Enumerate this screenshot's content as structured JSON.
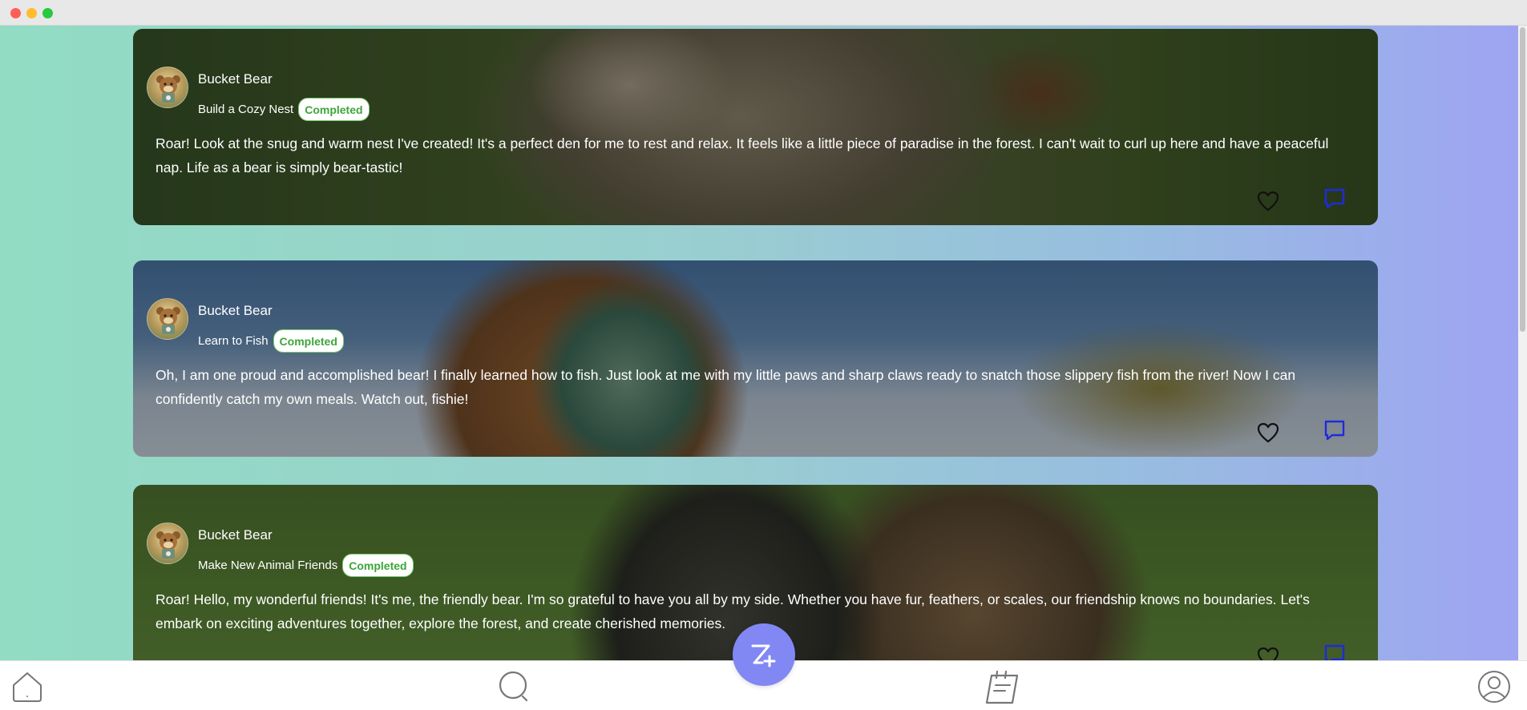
{
  "posts": [
    {
      "username": "Bucket Bear",
      "task": "Build a Cozy Nest",
      "status": "Completed",
      "text": "Roar! Look at the snug and warm nest I've created! It's a perfect den for me to rest and relax. It feels like a little piece of paradise in the forest. I can't wait to curl up here and have a peaceful nap. Life as a bear is simply bear-tastic!"
    },
    {
      "username": "Bucket Bear",
      "task": "Learn to Fish",
      "status": "Completed",
      "text": "Oh, I am one proud and accomplished bear! I finally learned how to fish. Just look at me with my little paws and sharp claws ready to snatch those slippery fish from the river! Now I can confidently catch my own meals. Watch out, fishie!"
    },
    {
      "username": "Bucket Bear",
      "task": "Make New Animal Friends",
      "status": "Completed",
      "text": "Roar! Hello, my wonderful friends! It's me, the friendly bear. I'm so grateful to have you all by my side. Whether you have fur, feathers, or scales, our friendship knows no boundaries. Let's embark on exciting adventures together, explore the forest, and create cherished memories."
    }
  ],
  "icons": {
    "like": "heart-icon",
    "comment": "comment-icon",
    "home": "home-icon",
    "search": "search-icon",
    "tasks": "notepad-icon",
    "profile": "user-icon",
    "create": "create-post-icon"
  },
  "colors": {
    "badge_text": "#3da63a",
    "fab": "#8188f4",
    "comment_icon": "#1f2bd9"
  }
}
